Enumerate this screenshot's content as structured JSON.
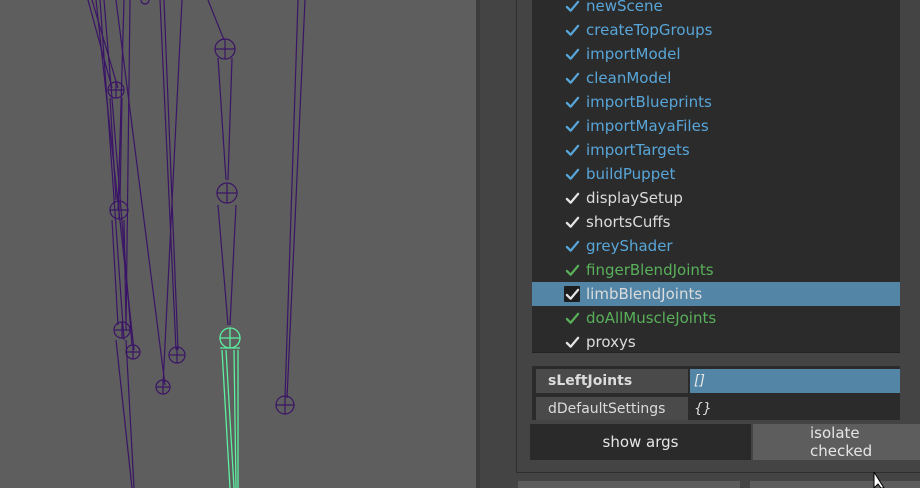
{
  "steps": [
    {
      "label": "newScene",
      "checked": true,
      "color": "#58a6d9"
    },
    {
      "label": "createTopGroups",
      "checked": true,
      "color": "#58a6d9"
    },
    {
      "label": "importModel",
      "checked": true,
      "color": "#58a6d9"
    },
    {
      "label": "cleanModel",
      "checked": true,
      "color": "#58a6d9"
    },
    {
      "label": "importBlueprints",
      "checked": true,
      "color": "#58a6d9"
    },
    {
      "label": "importMayaFiles",
      "checked": true,
      "color": "#58a6d9"
    },
    {
      "label": "importTargets",
      "checked": true,
      "color": "#58a6d9"
    },
    {
      "label": "buildPuppet",
      "checked": true,
      "color": "#58a6d9"
    },
    {
      "label": "displaySetup",
      "checked": true,
      "color": "#dcdcdc"
    },
    {
      "label": "shortsCuffs",
      "checked": true,
      "color": "#dcdcdc"
    },
    {
      "label": "greyShader",
      "checked": true,
      "color": "#58a6d9"
    },
    {
      "label": "fingerBlendJoints",
      "checked": true,
      "color": "#59b05a"
    },
    {
      "label": "limbBlendJoints",
      "checked": true,
      "color": "#dcdcdc",
      "selected": true
    },
    {
      "label": "doAllMuscleJoints",
      "checked": true,
      "color": "#59b05a"
    },
    {
      "label": "proxys",
      "checked": true,
      "color": "#dcdcdc"
    }
  ],
  "params": [
    {
      "key": "sLeftJoints",
      "value": "[]",
      "active": true
    },
    {
      "key": "dDefaultSettings",
      "value": "{}",
      "active": false
    }
  ],
  "buttons": {
    "show_args": "show args",
    "isolate_checked": "isolate checked"
  },
  "colors": {
    "viewport_bg": "#5e5e5e",
    "selection": "#5285a6",
    "joint_purple": "#3a1466",
    "joint_selected_green": "#5cf0a0"
  },
  "viewport": {
    "type": "3d-viewport",
    "content": "skeleton-joint-chains"
  }
}
